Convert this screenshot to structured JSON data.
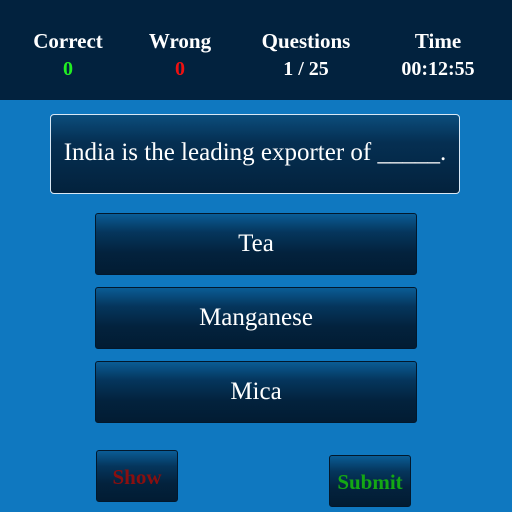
{
  "colors": {
    "background": "#0f78c0",
    "header_bg": "#02223e",
    "correct": "#22ee22",
    "wrong": "#ee1111",
    "show_text": "#8a0f0f",
    "submit_text": "#14a814",
    "text": "#ffffff"
  },
  "stats": {
    "correct": {
      "label": "Correct",
      "value": "0"
    },
    "wrong": {
      "label": "Wrong",
      "value": "0"
    },
    "questions": {
      "label": "Questions",
      "value": "1 / 25"
    },
    "time": {
      "label": "Time",
      "value": "00:12:55"
    }
  },
  "question": {
    "text": "India is the leading exporter of _____."
  },
  "options": [
    {
      "label": "Tea"
    },
    {
      "label": "Manganese"
    },
    {
      "label": "Mica"
    }
  ],
  "actions": {
    "show_label": "Show",
    "submit_label": "Submit"
  }
}
